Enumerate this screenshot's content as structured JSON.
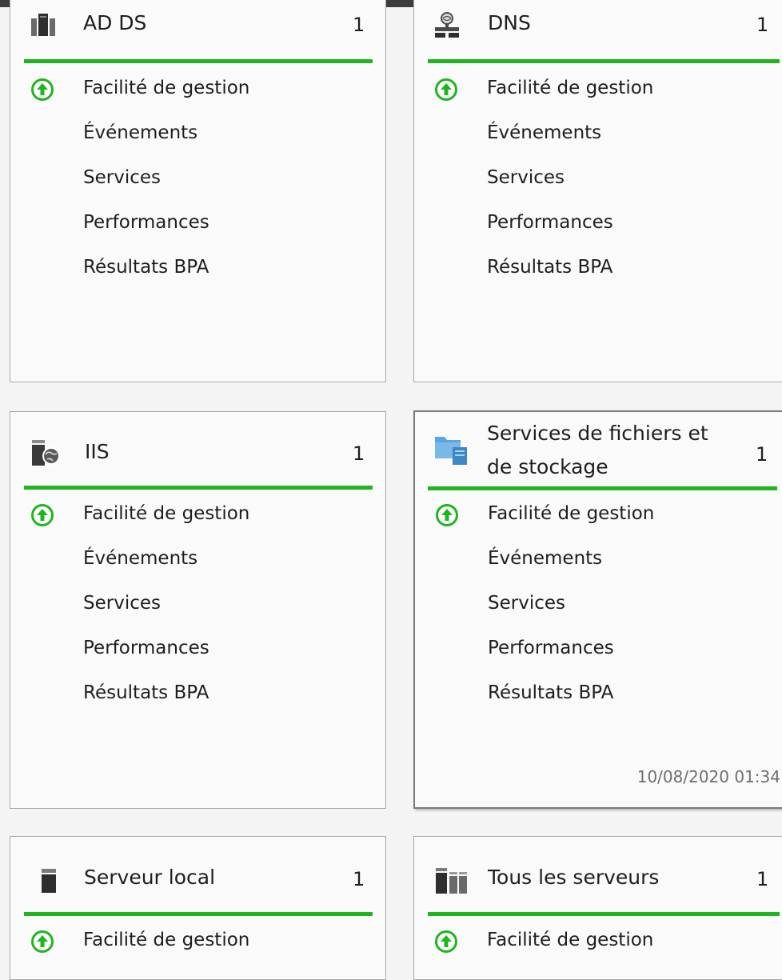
{
  "colors": {
    "status_green": "#1fb51f",
    "tile_border": "#a8a8a8",
    "text": "#1e1e1e",
    "timestamp_text": "#6e6e6e"
  },
  "tiles": [
    {
      "title": "AD DS",
      "count": "1",
      "icon": "ad-ds-server-icon",
      "rows": [
        "Facilité de gestion",
        "Événements",
        "Services",
        "Performances",
        "Résultats BPA"
      ]
    },
    {
      "title": "DNS",
      "count": "1",
      "icon": "dns-server-icon",
      "rows": [
        "Facilité de gestion",
        "Événements",
        "Services",
        "Performances",
        "Résultats BPA"
      ]
    },
    {
      "title": "IIS",
      "count": "1",
      "icon": "iis-server-icon",
      "rows": [
        "Facilité de gestion",
        "Événements",
        "Services",
        "Performances",
        "Résultats BPA"
      ]
    },
    {
      "title_line1": "Services de fichiers et",
      "title_line2": "de stockage",
      "count": "1",
      "icon": "file-storage-folder-icon",
      "rows": [
        "Facilité de gestion",
        "Événements",
        "Services",
        "Performances",
        "Résultats BPA"
      ],
      "timestamp": "10/08/2020 01:34"
    },
    {
      "title": "Serveur local",
      "count": "1",
      "icon": "local-server-icon",
      "rows": [
        "Facilité de gestion"
      ]
    },
    {
      "title": "Tous les serveurs",
      "count": "1",
      "icon": "all-servers-icon",
      "rows": [
        "Facilité de gestion"
      ]
    }
  ]
}
